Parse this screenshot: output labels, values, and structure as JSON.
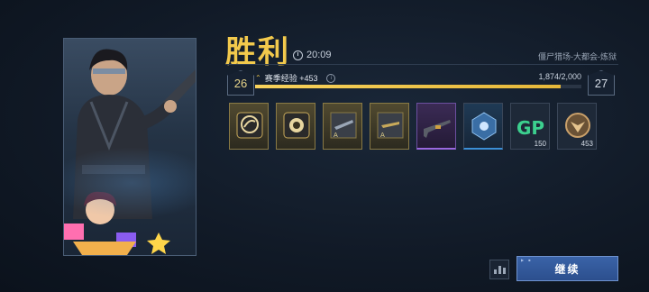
{
  "result": {
    "title": "胜利",
    "time": "20:09",
    "mode": "僵尸猎场-大都会-炼狱"
  },
  "xp": {
    "current_level": "26",
    "next_level": "27",
    "label": "赛季经验 +453",
    "value_text": "1,874/2,000",
    "progress": 0.937
  },
  "rewards": [
    {
      "type": "badge",
      "count": ""
    },
    {
      "type": "coin-badge",
      "count": ""
    },
    {
      "type": "weapon-blueprint-a",
      "count": ""
    },
    {
      "type": "weapon-blueprint-b",
      "count": ""
    },
    {
      "type": "rifle-skin",
      "count": ""
    },
    {
      "type": "blue-emblem",
      "count": ""
    },
    {
      "type": "gp-currency",
      "count": "150"
    },
    {
      "type": "bronze-emblem",
      "count": "453"
    }
  ],
  "buttons": {
    "continue": "继续"
  },
  "colors": {
    "accent": "#f2c94c",
    "button": "#2f5597"
  }
}
